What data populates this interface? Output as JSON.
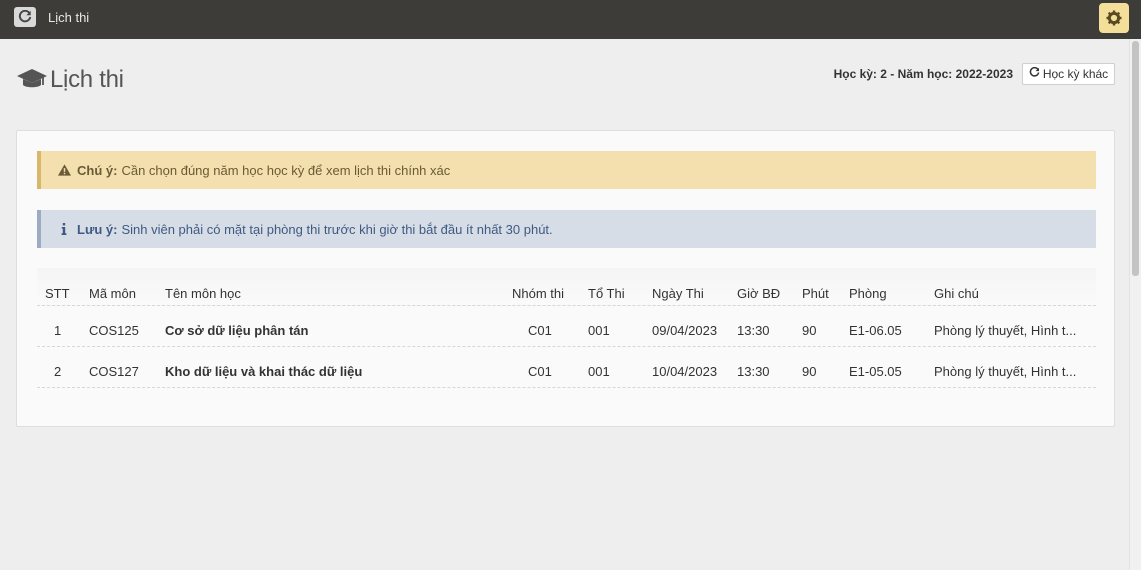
{
  "topbar": {
    "title": "Lịch thi",
    "refresh_icon": "refresh-icon",
    "settings_icon": "gear-icon"
  },
  "page": {
    "title": "Lịch thi",
    "icon": "graduation-cap-icon"
  },
  "term": {
    "label": "Học kỳ: 2 - Năm học: 2022-2023",
    "button_label": "Học kỳ khác",
    "button_icon": "refresh-icon"
  },
  "alerts": {
    "warning": {
      "strong": "Chú ý:",
      "text": "Cần chọn đúng năm học học kỳ để xem lịch thi chính xác",
      "icon": "warning-icon"
    },
    "info": {
      "strong": "Lưu ý:",
      "text": "Sinh viên phải có mặt tại phòng thi trước khi giờ thi bắt đầu ít nhất 30 phút.",
      "icon": "info-icon"
    }
  },
  "table": {
    "headers": [
      "STT",
      "Mã môn",
      "Tên môn học",
      "Nhóm thi",
      "Tổ Thi",
      "Ngày Thi",
      "Giờ BĐ",
      "Phút",
      "Phòng",
      "Ghi chú"
    ],
    "rows": [
      [
        "1",
        "COS125",
        "Cơ sở dữ liệu phân tán",
        "C01",
        "001",
        "09/04/2023",
        "13:30",
        "90",
        "E1-06.05",
        "Phòng lý thuyết, Hình t..."
      ],
      [
        "2",
        "COS127",
        "Kho dữ liệu và khai thác dữ liệu",
        "C01",
        "001",
        "10/04/2023",
        "13:30",
        "90",
        "E1-05.05",
        "Phòng lý thuyết, Hình t..."
      ]
    ]
  },
  "colors": {
    "topbar": "#3e3c39",
    "warning_bg": "#f3e0ae",
    "info_bg": "#d7dde6",
    "settings_bg": "#f3df9a"
  }
}
